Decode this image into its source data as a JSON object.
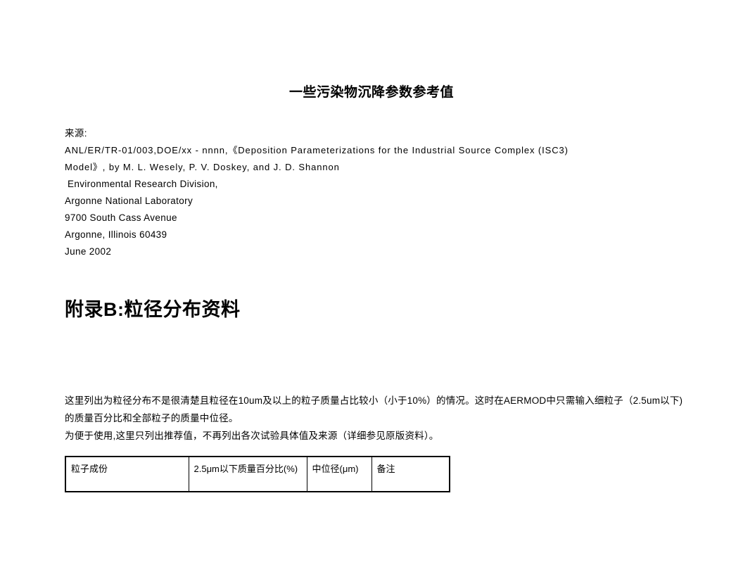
{
  "document": {
    "title": "一些污染物沉降参数参考值",
    "source_label": "来源:",
    "citation_lines": [
      "ANL/ER/TR-01/003,DOE/xx - nnnn,《Deposition Parameterizations for the  Industrial  Source Complex (ISC3)",
      "Model》, by M. L. Wesely, P.  V.  Doskey,    and   J.  D. Shannon",
      "Environmental Research Division,",
      "Argonne National  Laboratory",
      "9700 South Cass Avenue",
      "Argonne,  Illinois 60439",
      "June  2002"
    ],
    "appendix_heading": "附录B:粒径分布资料",
    "paragraph_lines": [
      "这里列出为粒径分布不是很清楚且粒径在10um及以上的粒子质量占比较小（小于10%）的情况。这时在AERMOD中只需输入细粒子（2.5um以下)的质量百分比和全部粒子的质量中位径。",
      "为便于使用,这里只列出推荐值，不再列出各次试验具体值及来源（详细参见原版资料）。"
    ],
    "table": {
      "headers": [
        "粒子成份",
        "2.5μm以下质量百分比(%)",
        "中位径(μm)",
        "备注"
      ],
      "rows": []
    }
  }
}
